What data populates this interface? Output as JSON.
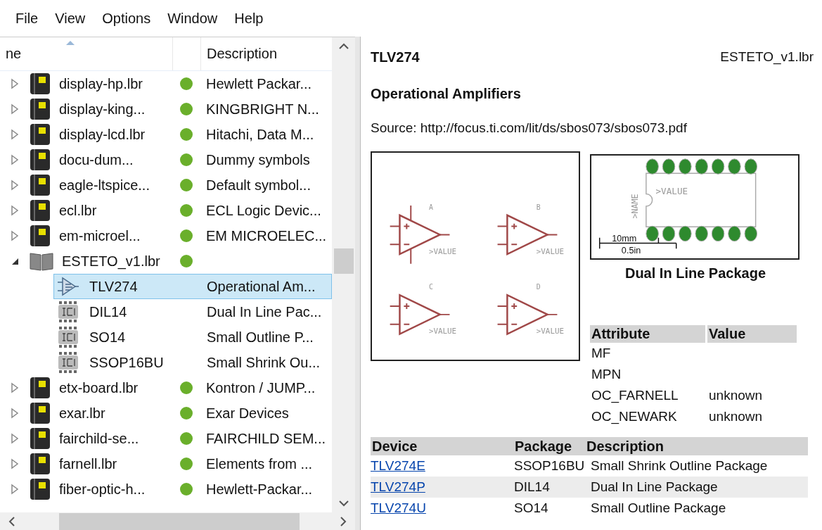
{
  "menu": [
    {
      "label": "File"
    },
    {
      "label": "View"
    },
    {
      "label": "Options"
    },
    {
      "label": "Window"
    },
    {
      "label": "Help"
    }
  ],
  "tree": {
    "columns": [
      {
        "label": "ne",
        "sorted": true
      },
      {
        "label": "Description",
        "sorted": false
      }
    ],
    "items": [
      {
        "kind": "library",
        "name": "display-hp.lbr",
        "description": "Hewlett Packar...",
        "in_use": true,
        "expanded": false
      },
      {
        "kind": "library",
        "name": "display-king...",
        "description": "KINGBRIGHT N...",
        "in_use": true,
        "expanded": false
      },
      {
        "kind": "library",
        "name": "display-lcd.lbr",
        "description": "Hitachi, Data M...",
        "in_use": true,
        "expanded": false
      },
      {
        "kind": "library",
        "name": "docu-dum...",
        "description": "Dummy symbols",
        "in_use": true,
        "expanded": false
      },
      {
        "kind": "library",
        "name": "eagle-ltspice...",
        "description": "Default symbol...",
        "in_use": true,
        "expanded": false
      },
      {
        "kind": "library",
        "name": "ecl.lbr",
        "description": "ECL Logic Devic...",
        "in_use": true,
        "expanded": false
      },
      {
        "kind": "library",
        "name": "em-microel...",
        "description": "EM MICROELEC...",
        "in_use": true,
        "expanded": false
      },
      {
        "kind": "library",
        "name": "ESTETO_v1.lbr",
        "in_use": true,
        "expanded": true,
        "children": [
          {
            "kind": "device",
            "name": "TLV274",
            "description": "Operational Am...",
            "selected": true
          },
          {
            "kind": "package",
            "name": "DIL14",
            "description": "Dual In Line Pac...",
            "selected": false
          },
          {
            "kind": "package",
            "name": "SO14",
            "description": "Small Outline P...",
            "selected": false
          },
          {
            "kind": "package",
            "name": "SSOP16BU",
            "description": "Small Shrink Ou...",
            "selected": false
          }
        ]
      },
      {
        "kind": "library",
        "name": "etx-board.lbr",
        "description": "Kontron / JUMP...",
        "in_use": true,
        "expanded": false
      },
      {
        "kind": "library",
        "name": "exar.lbr",
        "description": "Exar Devices",
        "in_use": true,
        "expanded": false
      },
      {
        "kind": "library",
        "name": "fairchild-se...",
        "description": "FAIRCHILD SEM...",
        "in_use": true,
        "expanded": false
      },
      {
        "kind": "library",
        "name": "farnell.lbr",
        "description": "Elements from ...",
        "in_use": true,
        "expanded": false
      },
      {
        "kind": "library",
        "name": "fiber-optic-h...",
        "description": "Hewlett-Packar...",
        "in_use": true,
        "expanded": false
      }
    ]
  },
  "detail": {
    "title": "TLV274",
    "library": "ESTETO_v1.lbr",
    "heading": "Operational Amplifiers",
    "source": "Source: http://focus.ti.com/lit/ds/sbos073/sbos073.pdf",
    "symbol": {
      "gates": [
        {
          "name": "A",
          "value": ">VALUE",
          "supply": true
        },
        {
          "name": "B",
          "value": ">VALUE",
          "supply": false
        },
        {
          "name": "C",
          "value": ">VALUE",
          "supply": false
        },
        {
          "name": "D",
          "value": ">VALUE",
          "supply": false
        }
      ]
    },
    "package": {
      "name_label": ">NAME",
      "value_label": ">VALUE",
      "scale_metric": "10mm",
      "scale_imperial": "0.5in",
      "caption": "Dual In Line Package"
    },
    "attributes": {
      "columns": [
        "Attribute",
        "Value"
      ],
      "rows": [
        {
          "attribute": "MF"
        },
        {
          "attribute": "MPN"
        },
        {
          "attribute": "OC_FARNELL",
          "value": "unknown"
        },
        {
          "attribute": "OC_NEWARK",
          "value": "unknown"
        }
      ]
    },
    "devices": {
      "columns": [
        "Device",
        "Package",
        "Description"
      ],
      "rows": [
        {
          "device": "TLV274E",
          "package": "SSOP16BU",
          "description": "Small Shrink Outline Package"
        },
        {
          "device": "TLV274P",
          "package": "DIL14",
          "description": "Dual In Line Package"
        },
        {
          "device": "TLV274U",
          "package": "SO14",
          "description": "Small Outline Package"
        }
      ]
    }
  }
}
